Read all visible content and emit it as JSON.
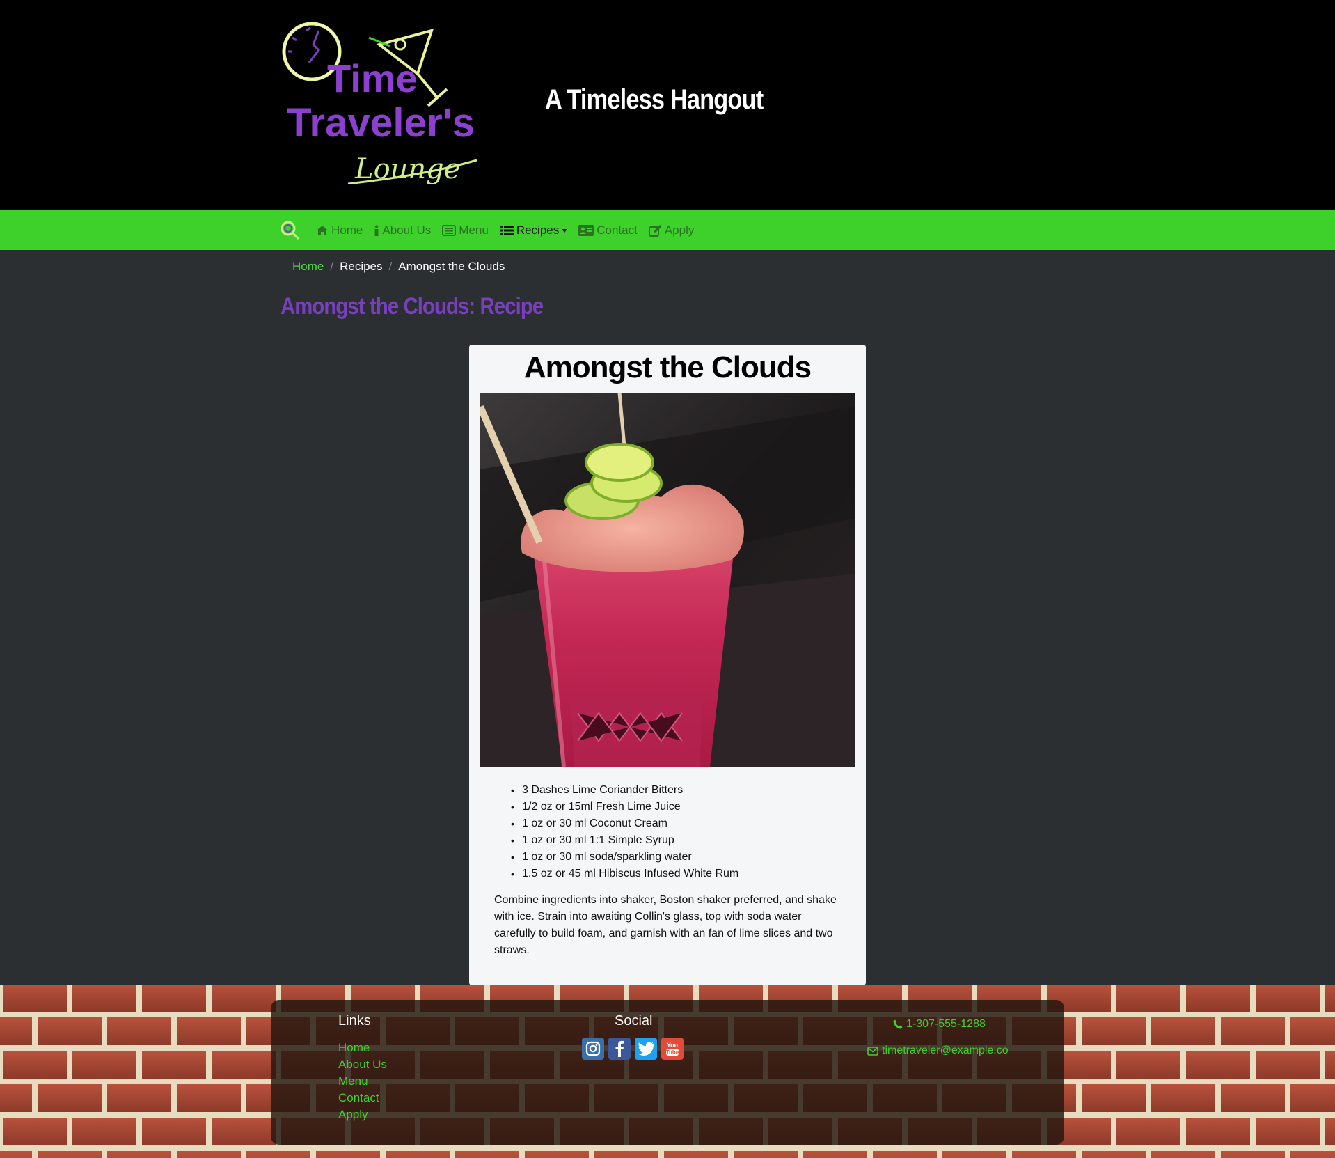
{
  "header": {
    "logo": {
      "line1": "Time",
      "line2": "Traveler's",
      "line3": "Lounge"
    },
    "tagline": "A Timeless Hangout"
  },
  "nav": {
    "items": [
      {
        "label": "Home",
        "icon": "home-icon"
      },
      {
        "label": "About Us",
        "icon": "info-icon"
      },
      {
        "label": "Menu",
        "icon": "list-alt-icon"
      },
      {
        "label": "Recipes",
        "icon": "list-icon"
      },
      {
        "label": "Contact",
        "icon": "address-card-icon"
      },
      {
        "label": "Apply",
        "icon": "edit-icon"
      }
    ],
    "accent": "#3fd12b"
  },
  "breadcrumb": {
    "home": "Home",
    "section": "Recipes",
    "current": "Amongst the Clouds"
  },
  "page_title": "Amongst the Clouds: Recipe",
  "recipe": {
    "title": "Amongst the Clouds",
    "ingredients": [
      "3 Dashes Lime Coriander Bitters",
      "1/2 oz or 15ml Fresh Lime Juice",
      "1 oz or 30 ml Coconut Cream",
      "1 oz or 30 ml 1:1 Simple Syrup",
      "1 oz or 30 ml soda/sparkling water",
      "1.5 oz or 45 ml Hibiscus Infused White Rum"
    ],
    "instructions": "Combine ingredients into shaker, Boston shaker preferred, and shake with ice. Strain into awaiting Collin's glass, top with soda water carefully to build foam, and garnish with an fan of lime slices and two straws."
  },
  "footer": {
    "links_title": "Links",
    "links": [
      "Home",
      "About Us",
      "Menu",
      "Contact",
      "Apply"
    ],
    "social_title": "Social",
    "social": [
      "instagram-icon",
      "facebook-icon",
      "twitter-icon",
      "youtube-icon"
    ],
    "phone": "1-307-555-1288",
    "email": "timetraveler@example.co"
  },
  "colors": {
    "brand_purple": "#7a3fbf",
    "link_green": "#3fd12b",
    "page_bg": "#2b2f31"
  }
}
